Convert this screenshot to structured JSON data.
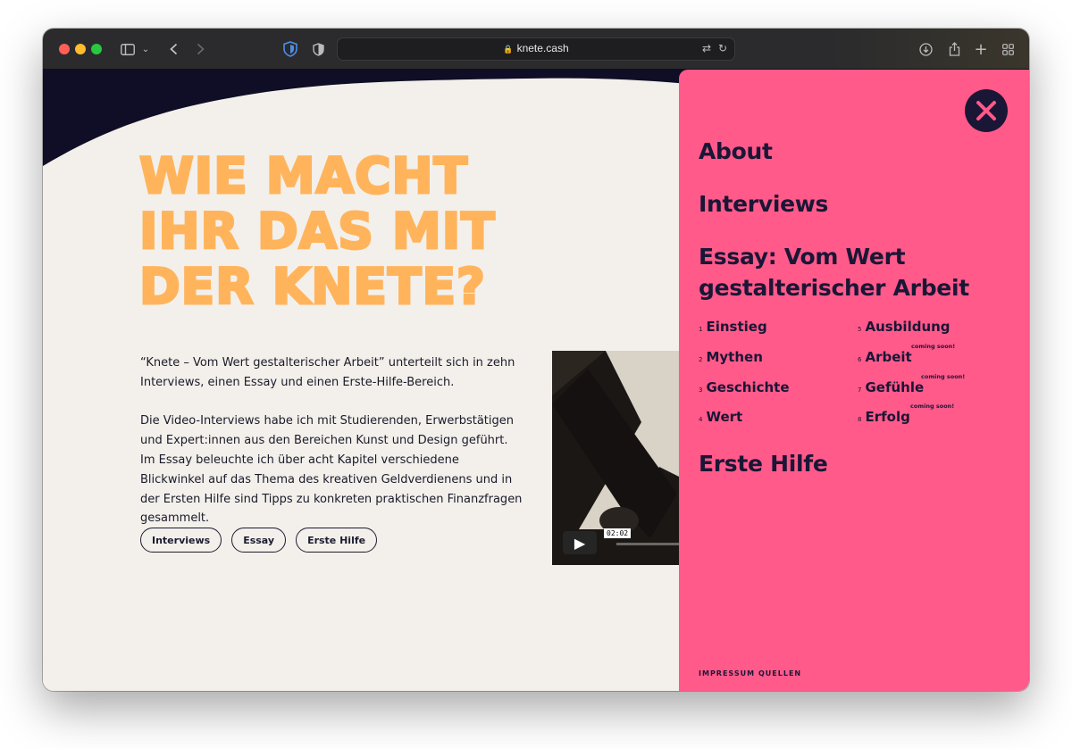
{
  "browser": {
    "url": "knete.cash",
    "colors": {
      "toolbar": "#2b2b2d",
      "red": "#fe5f57",
      "yellow": "#febc2e",
      "green": "#28c840"
    },
    "icons": [
      "sidebar-icon",
      "chevron-down-icon",
      "back-icon",
      "forward-icon",
      "bitwarden-shield-icon",
      "privacy-shield-icon",
      "lock-icon",
      "translate-icon",
      "reload-icon",
      "download-icon",
      "share-icon",
      "new-tab-icon",
      "tab-overview-icon"
    ]
  },
  "hero": {
    "title_lines": [
      "WIE MACHT",
      "IHR DAS MIT",
      "DER KNETE?"
    ],
    "intro_p1": "“Knete – Vom Wert gestalterischer Arbeit” unterteilt sich in zehn Interviews, einen Essay und einen Erste-Hilfe-Bereich.",
    "intro_p2": "Die Video-Interviews habe ich mit Studierenden, Erwerbstätigen und Expert:innen aus den Bereichen Kunst und Design geführt. Im Essay beleuchte ich über acht Kapitel verschiedene Blickwinkel auf das Thema des kreativen Geldverdienens und in der Ersten Hilfe sind Tipps zu konkreten praktischen Finanzfragen gesammelt.",
    "pills": [
      "Interviews",
      "Essay",
      "Erste Hilfe"
    ],
    "colors": {
      "title": "#ffb45c",
      "background": "#f3f0eb",
      "dark": "#0f0e26"
    }
  },
  "video": {
    "timecode": "02:02",
    "play_icon": "play-icon"
  },
  "menu": {
    "about": "About",
    "interviews": "Interviews",
    "essay_line1": "Essay: Vom Wert",
    "essay_line2": "gestalterischer Arbeit",
    "chapters": [
      {
        "num": "1",
        "label": "Einstieg",
        "note": ""
      },
      {
        "num": "2",
        "label": "Mythen",
        "note": ""
      },
      {
        "num": "3",
        "label": "Geschichte",
        "note": ""
      },
      {
        "num": "4",
        "label": "Wert",
        "note": ""
      },
      {
        "num": "5",
        "label": "Ausbildung",
        "note": ""
      },
      {
        "num": "6",
        "label": "Arbeit",
        "note": "coming soon!"
      },
      {
        "num": "7",
        "label": "Gefühle",
        "note": "coming soon!"
      },
      {
        "num": "8",
        "label": "Erfolg",
        "note": "coming soon!"
      }
    ],
    "erste_hilfe": "Erste Hilfe",
    "footer": [
      "IMPRESSUM",
      "QUELLEN"
    ],
    "colors": {
      "panel": "#ff5a8a",
      "ink": "#1a1636"
    }
  }
}
